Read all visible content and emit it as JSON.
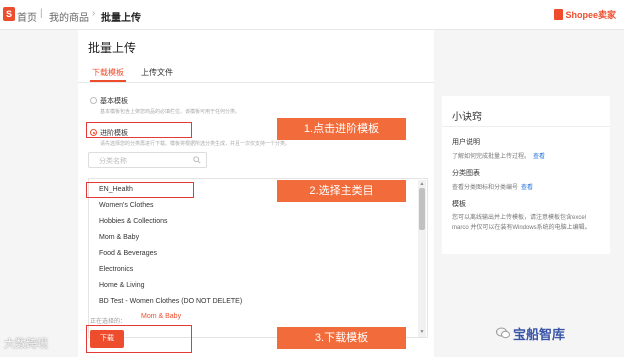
{
  "breadcrumb": {
    "home": "首页",
    "products": "我的商品",
    "current": "批量上传"
  },
  "brand": {
    "name": "Shopee卖家",
    "logo_letter": "S"
  },
  "page": {
    "title": "批量上传"
  },
  "tabs": [
    {
      "label": "下载模板",
      "active": true
    },
    {
      "label": "上传文件",
      "active": false
    }
  ],
  "template_options": [
    {
      "label": "基本模板",
      "desc": "基本模板包含上架您商品的必填栏位。该模板可用于任何分类。",
      "checked": false
    },
    {
      "label": "进阶模板",
      "desc": "请先选择您的分类再进行下载。模板将根据所选分类生成，并且一次仅支持一个分类。",
      "checked": true
    }
  ],
  "search": {
    "placeholder": "分类名称"
  },
  "categories": [
    "EN_Health",
    "Women's Clothes",
    "Hobbies & Collections",
    "Mom & Baby",
    "Food & Beverages",
    "Electronics",
    "Home & Living",
    "BD Test - Women Clothes (DO NOT DELETE)"
  ],
  "selection": {
    "label": "正在选择的：",
    "value": "Mom & Baby"
  },
  "download_button": {
    "label": "下载"
  },
  "callouts": [
    "1.点击进阶模板",
    "2.选择主类目",
    "3.下载模板"
  ],
  "tips": {
    "title": "小诀窍",
    "sections": [
      {
        "heading": "用户说明",
        "text": "了解如何完成批量上传过程。",
        "link": "查看"
      },
      {
        "heading": "分类图表",
        "text": "查看分类图标和分类编号",
        "link": "查看"
      },
      {
        "heading": "模板",
        "lines": [
          "您可以离线输出并上传模板，请注意模板包含excel",
          "marco 并仅可以在装有Windows系统的电脑上编辑。"
        ]
      }
    ]
  },
  "watermarks": {
    "left": "大数跨境",
    "right": "宝船智库"
  },
  "colors": {
    "accent": "#ee4d2d",
    "callout": "#f26b3a",
    "highlight_box": "#e53935",
    "link": "#2673dd"
  }
}
